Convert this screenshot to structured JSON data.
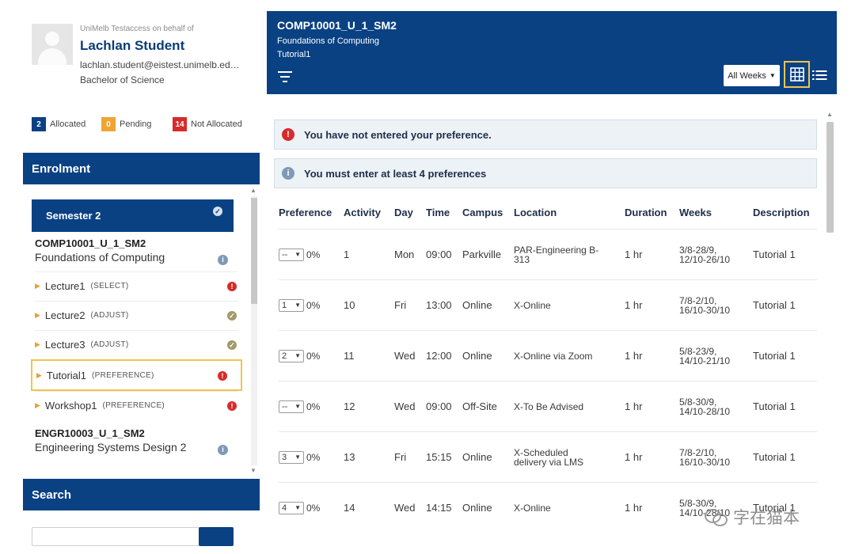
{
  "profile": {
    "behalf": "UniMelb Testaccess on behalf of",
    "name": "Lachlan Student",
    "email": "lachlan.student@eistest.unimelb.ed…",
    "degree": "Bachelor of Science"
  },
  "legend": {
    "allocated_count": "2",
    "allocated_label": "Allocated",
    "pending_count": "0",
    "pending_label": "Pending",
    "not_allocated_count": "14",
    "not_allocated_label": "Not Allocated"
  },
  "enrolment": {
    "title": "Enrolment",
    "semester": "Semester 2",
    "courses": [
      {
        "code": "COMP10001_U_1_SM2",
        "name": "Foundations of Computing",
        "activities": [
          {
            "name": "Lecture1",
            "type": "(SELECT)",
            "status": "error"
          },
          {
            "name": "Lecture2",
            "type": "(ADJUST)",
            "status": "ok"
          },
          {
            "name": "Lecture3",
            "type": "(ADJUST)",
            "status": "ok"
          },
          {
            "name": "Tutorial1",
            "type": "(PREFERENCE)",
            "status": "error"
          },
          {
            "name": "Workshop1",
            "type": "(PREFERENCE)",
            "status": "error"
          }
        ]
      },
      {
        "code": "ENGR10003_U_1_SM2",
        "name": "Engineering Systems Design 2"
      }
    ]
  },
  "search": {
    "title": "Search"
  },
  "header": {
    "code": "COMP10001_U_1_SM2",
    "name": "Foundations of Computing",
    "activity": "Tutorial1",
    "weeks_select": "All Weeks"
  },
  "alerts": {
    "preference": "You have not entered your preference.",
    "minimum": "You must enter at least 4 preferences"
  },
  "table": {
    "headers": [
      "Preference",
      "Activity",
      "Day",
      "Time",
      "Campus",
      "Location",
      "Duration",
      "Weeks",
      "Description"
    ],
    "rows": [
      {
        "pref": "--",
        "pct": "0%",
        "activity": "1",
        "day": "Mon",
        "time": "09:00",
        "campus": "Parkville",
        "location_1": "PAR-Engineering B-",
        "location_2": "313",
        "duration": "1 hr",
        "weeks_1": "3/8-28/9,",
        "weeks_2": "12/10-26/10",
        "description": "Tutorial 1"
      },
      {
        "pref": "1",
        "pct": "0%",
        "activity": "10",
        "day": "Fri",
        "time": "13:00",
        "campus": "Online",
        "location_1": "X-Online",
        "location_2": "",
        "duration": "1 hr",
        "weeks_1": "7/8-2/10,",
        "weeks_2": "16/10-30/10",
        "description": "Tutorial 1"
      },
      {
        "pref": "2",
        "pct": "0%",
        "activity": "11",
        "day": "Wed",
        "time": "12:00",
        "campus": "Online",
        "location_1": "X-Online via Zoom",
        "location_2": "",
        "duration": "1 hr",
        "weeks_1": "5/8-23/9,",
        "weeks_2": "14/10-21/10",
        "description": "Tutorial 1"
      },
      {
        "pref": "--",
        "pct": "0%",
        "activity": "12",
        "day": "Wed",
        "time": "09:00",
        "campus": "Off-Site",
        "location_1": "X-To Be Advised",
        "location_2": "",
        "duration": "1 hr",
        "weeks_1": "5/8-30/9,",
        "weeks_2": "14/10-28/10",
        "description": "Tutorial 1"
      },
      {
        "pref": "3",
        "pct": "0%",
        "activity": "13",
        "day": "Fri",
        "time": "15:15",
        "campus": "Online",
        "location_1": "X-Scheduled",
        "location_2": "delivery via LMS",
        "duration": "1 hr",
        "weeks_1": "7/8-2/10,",
        "weeks_2": "16/10-30/10",
        "description": "Tutorial 1"
      },
      {
        "pref": "4",
        "pct": "0%",
        "activity": "14",
        "day": "Wed",
        "time": "14:15",
        "campus": "Online",
        "location_1": "X-Online",
        "location_2": "",
        "duration": "1 hr",
        "weeks_1": "5/8-30/9,",
        "weeks_2": "14/10-28/10",
        "description": "Tutorial 1"
      }
    ]
  },
  "watermark": "字在猫本",
  "colors": {
    "brand_navy": "#094183",
    "pending_orange": "#f0a434",
    "error_red": "#d72b2b",
    "selected_gold": "#f2c44d"
  }
}
